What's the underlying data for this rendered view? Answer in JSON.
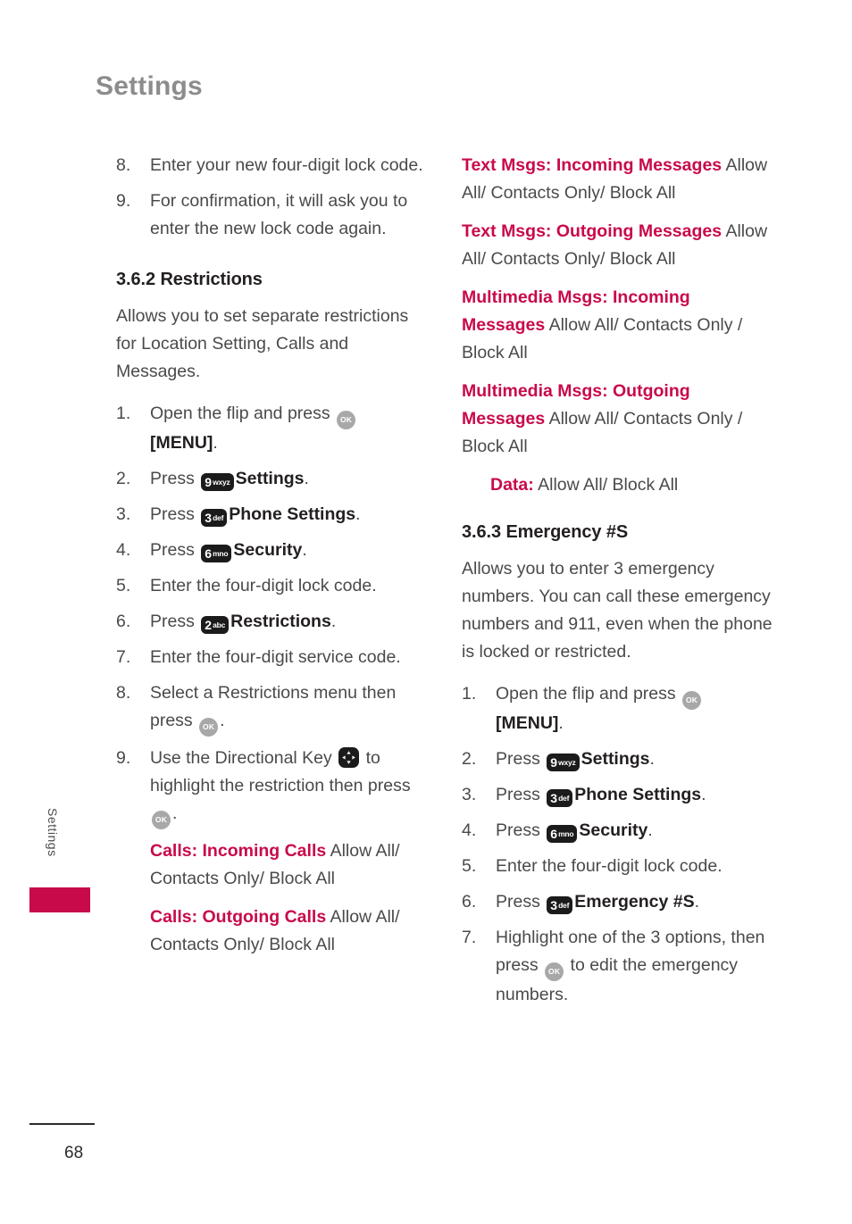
{
  "accent_color": "#c80a4b",
  "header": {
    "title": "Settings"
  },
  "side_tab": {
    "label": "Settings"
  },
  "footer": {
    "page_number": "68"
  },
  "left_column": {
    "continued_steps": [
      {
        "num": "8.",
        "text": "Enter your new four-digit lock code."
      },
      {
        "num": "9.",
        "text": "For confirmation, it will ask you to enter the new lock code again."
      }
    ],
    "section": {
      "heading": "3.6.2 Restrictions",
      "intro": "Allows you to set separate restrictions for Location Setting, Calls and Messages.",
      "steps": [
        {
          "num": "1.",
          "pre": "Open the flip and press ",
          "icon": "ok-key-icon",
          "post": "",
          "bold": "[MENU]",
          "tail": "."
        },
        {
          "num": "2.",
          "pre": "Press ",
          "key_digit": "9",
          "key_letters": "wxyz",
          "bold": "Settings",
          "tail": "."
        },
        {
          "num": "3.",
          "pre": "Press ",
          "key_digit": "3",
          "key_letters": "def",
          "bold": "Phone Settings",
          "tail": "."
        },
        {
          "num": "4.",
          "pre": "Press ",
          "key_digit": "6",
          "key_letters": "mno",
          "bold": "Security",
          "tail": "."
        },
        {
          "num": "5.",
          "text": "Enter the four-digit lock code."
        },
        {
          "num": "6.",
          "pre": "Press ",
          "key_digit": "2",
          "key_letters": "abc",
          "bold": "Restrictions",
          "tail": "."
        },
        {
          "num": "7.",
          "text": "Enter the four-digit service code."
        },
        {
          "num": "8.",
          "pre": "Select a Restrictions menu then press ",
          "icon": "ok-key-icon",
          "tail": "."
        },
        {
          "num": "9.",
          "pre": "Use the Directional Key ",
          "icon": "directional-key-icon",
          "mid": " to highlight the restriction then press ",
          "icon2": "ok-key-icon",
          "tail": "."
        }
      ],
      "restrictions": [
        {
          "term": "Calls: Incoming Calls",
          "options": "Allow All/ Contacts Only/ Block All"
        },
        {
          "term": "Calls: Outgoing Calls",
          "options": "Allow All/ Contacts Only/ Block All"
        }
      ]
    }
  },
  "right_column": {
    "restrictions_continued": [
      {
        "term": "Text Msgs: Incoming Messages",
        "options": "Allow All/ Contacts Only/ Block All"
      },
      {
        "term": "Text Msgs: Outgoing Messages",
        "options": "Allow All/ Contacts Only/ Block All"
      },
      {
        "term": "Multimedia Msgs: Incoming Messages",
        "options": "Allow All/ Contacts Only / Block All"
      },
      {
        "term": "Multimedia Msgs: Outgoing Messages",
        "options": "Allow All/ Contacts Only / Block All"
      },
      {
        "term": "Data:",
        "options": "Allow All/ Block All"
      }
    ],
    "section": {
      "heading": "3.6.3 Emergency #S",
      "intro": "Allows you to enter 3 emergency numbers. You can call these emergency numbers and 911, even when the phone is locked or restricted.",
      "steps": [
        {
          "num": "1.",
          "pre": "Open the flip and press ",
          "icon": "ok-key-icon",
          "bold": "[MENU]",
          "tail": "."
        },
        {
          "num": "2.",
          "pre": "Press ",
          "key_digit": "9",
          "key_letters": "wxyz",
          "bold": "Settings",
          "tail": "."
        },
        {
          "num": "3.",
          "pre": "Press ",
          "key_digit": "3",
          "key_letters": "def",
          "bold": "Phone Settings",
          "tail": "."
        },
        {
          "num": "4.",
          "pre": "Press ",
          "key_digit": "6",
          "key_letters": "mno",
          "bold": "Security",
          "tail": "."
        },
        {
          "num": "5.",
          "text": "Enter the four-digit lock code."
        },
        {
          "num": "6.",
          "pre": "Press ",
          "key_digit": "3",
          "key_letters": "def",
          "bold": "Emergency #S",
          "tail": "."
        },
        {
          "num": "7.",
          "pre": "Highlight one of the 3 options, then press ",
          "icon": "ok-key-icon",
          "mid": " to edit the emergency numbers.",
          "tail": ""
        }
      ]
    }
  }
}
